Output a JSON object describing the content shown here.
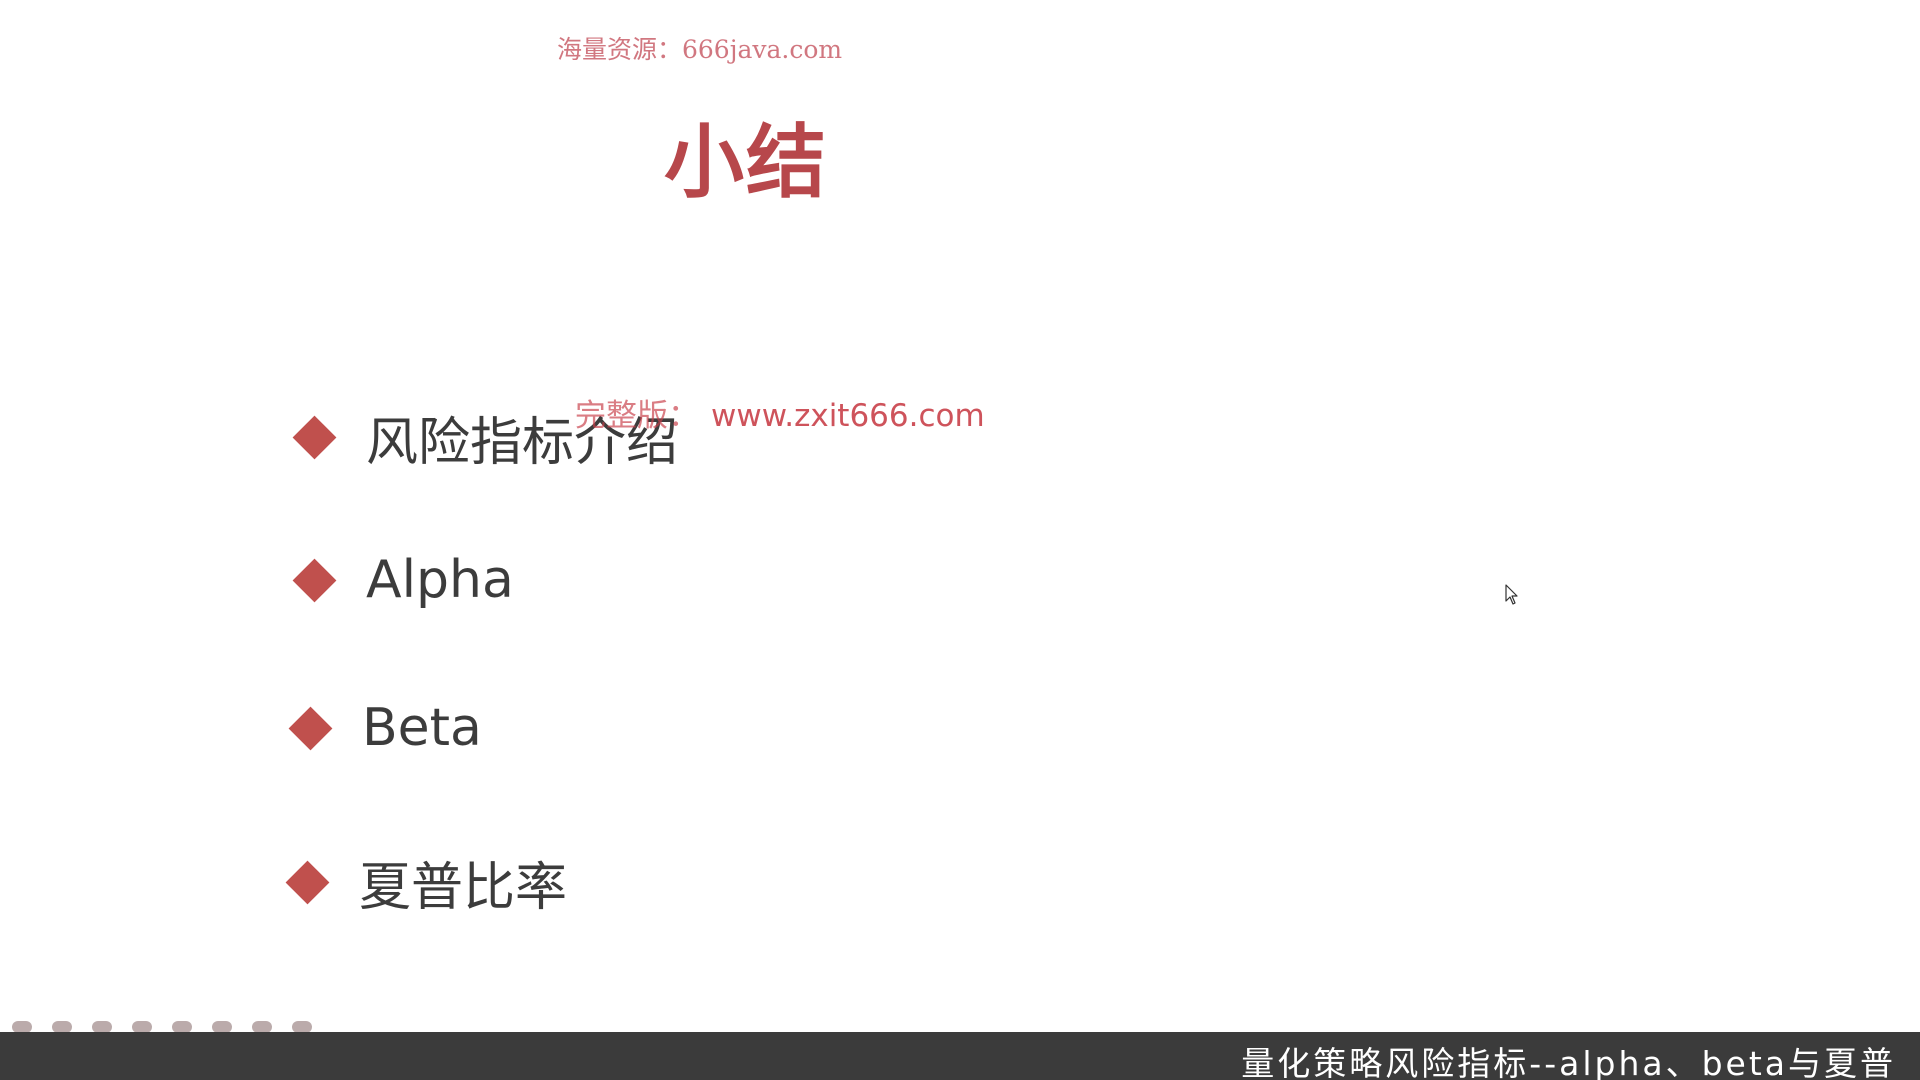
{
  "watermark_top": "海量资源：666java.com",
  "slide_title": "小结",
  "bullets": [
    "风险指标介绍",
    "Alpha",
    "Beta",
    "夏普比率"
  ],
  "watermark_mid": {
    "label": "完整版：",
    "url": "www.zxit666.com"
  },
  "caption": "量化策略风险指标--alpha、beta与夏普",
  "colors": {
    "title": "#b7474b",
    "bullet_marker": "#c0504d",
    "caption_bar": "#3b3b3b"
  }
}
